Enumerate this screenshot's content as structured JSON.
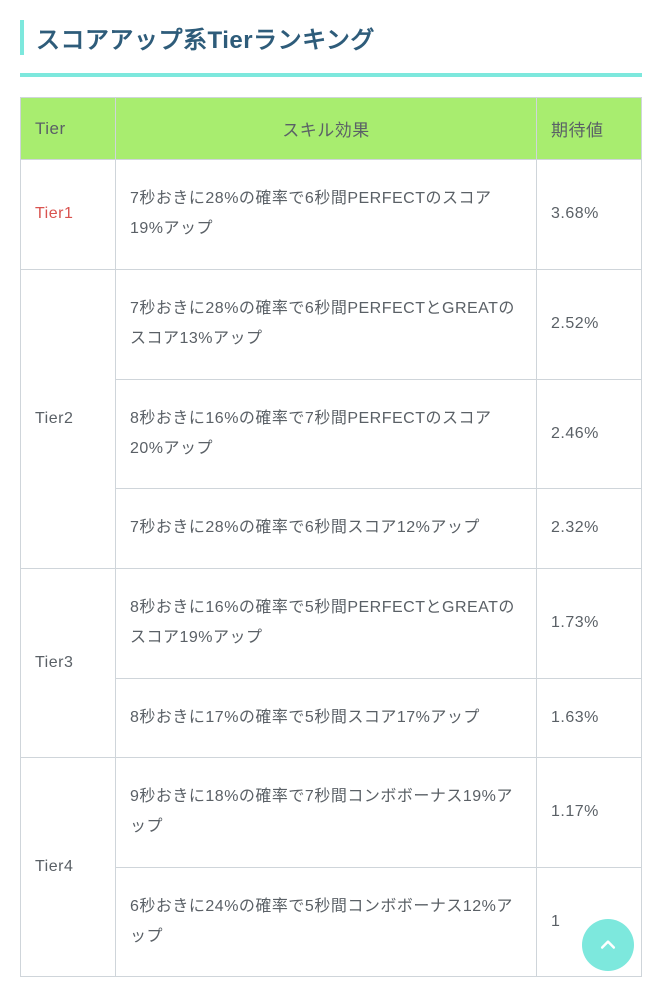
{
  "heading": "スコアアップ系Tierランキング",
  "table": {
    "headers": {
      "tier": "Tier",
      "effect": "スキル効果",
      "value": "期待値"
    },
    "groups": [
      {
        "tier": "Tier1",
        "highlight": true,
        "rows": [
          {
            "effect": "7秒おきに28%の確率で6秒間PERFECTのスコア19%アップ",
            "value": "3.68%"
          }
        ]
      },
      {
        "tier": "Tier2",
        "highlight": false,
        "rows": [
          {
            "effect": "7秒おきに28%の確率で6秒間PERFECTとGREATのスコア13%アップ",
            "value": "2.52%"
          },
          {
            "effect": "8秒おきに16%の確率で7秒間PERFECTのスコア20%アップ",
            "value": "2.46%"
          },
          {
            "effect": "7秒おきに28%の確率で6秒間スコア12%アップ",
            "value": "2.32%"
          }
        ]
      },
      {
        "tier": "Tier3",
        "highlight": false,
        "rows": [
          {
            "effect": "8秒おきに16%の確率で5秒間PERFECTとGREATのスコア19%アップ",
            "value": "1.73%"
          },
          {
            "effect": "8秒おきに17%の確率で5秒間スコア17%アップ",
            "value": "1.63%"
          }
        ]
      },
      {
        "tier": "Tier4",
        "highlight": false,
        "rows": [
          {
            "effect": "9秒おきに18%の確率で7秒間コンボボーナス19%アップ",
            "value": "1.17%"
          },
          {
            "effect": "6秒おきに24%の確率で5秒間コンボボーナス12%アップ",
            "value": "1"
          }
        ]
      }
    ]
  }
}
